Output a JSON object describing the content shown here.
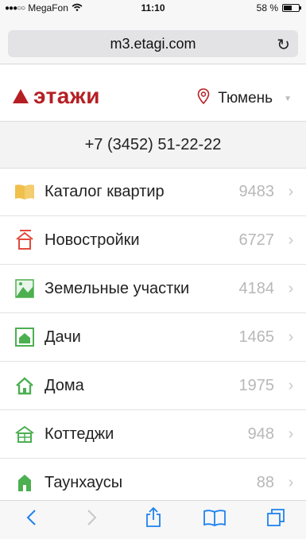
{
  "status_bar": {
    "carrier": "MegaFon",
    "time": "11:10",
    "battery": "58 %",
    "battery_level": 0.58
  },
  "browser": {
    "url": "m3.etagi.com"
  },
  "header": {
    "logo_text": "этажи",
    "city": "Тюмень"
  },
  "phone": "+7 (3452) 51-22-22",
  "menu": [
    {
      "label": "Каталог квартир",
      "count": "9483",
      "icon": "book-icon",
      "color": "#f0c04a"
    },
    {
      "label": "Новостройки",
      "count": "6727",
      "icon": "crane-house-icon",
      "color": "#e24a3d"
    },
    {
      "label": "Земельные участки",
      "count": "4184",
      "icon": "land-icon",
      "color": "#4caf50"
    },
    {
      "label": "Дачи",
      "count": "1465",
      "icon": "dacha-icon",
      "color": "#4caf50"
    },
    {
      "label": "Дома",
      "count": "1975",
      "icon": "house-icon",
      "color": "#4caf50"
    },
    {
      "label": "Коттеджи",
      "count": "948",
      "icon": "cottage-icon",
      "color": "#4caf50"
    },
    {
      "label": "Таунхаусы",
      "count": "88",
      "icon": "townhouse-icon",
      "color": "#4caf50"
    }
  ],
  "colors": {
    "brand": "#b51f24",
    "toolbar_accent": "#1e82f0"
  }
}
